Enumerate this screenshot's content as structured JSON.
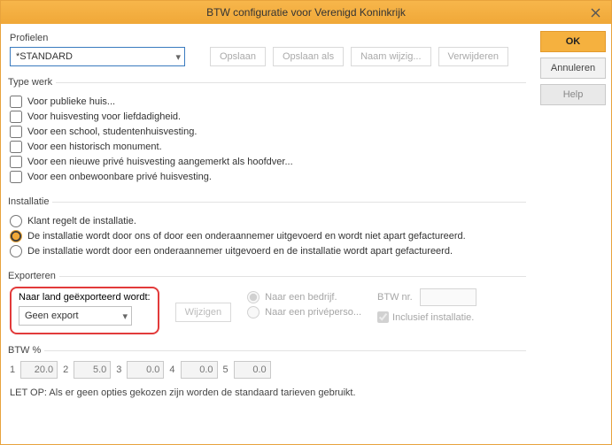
{
  "titlebar": {
    "title": "BTW configuratie voor Verenigd Koninkrijk"
  },
  "side": {
    "ok": "OK",
    "cancel": "Annuleren",
    "help": "Help"
  },
  "profiles": {
    "label": "Profielen",
    "selected": "*STANDARD",
    "buttons": {
      "save": "Opslaan",
      "saveas": "Opslaan als",
      "rename": "Naam wijzig...",
      "delete": "Verwijderen"
    }
  },
  "worktype": {
    "legend": "Type werk",
    "items": [
      "Voor publieke huis...",
      "Voor huisvesting voor liefdadigheid.",
      "Voor een school, studentenhuisvesting.",
      "Voor een historisch monument.",
      "Voor een nieuwe privé huisvesting aangemerkt als hoofdver...",
      "Voor een onbewoonbare privé huisvesting."
    ]
  },
  "install": {
    "legend": "Installatie",
    "options": [
      "Klant regelt de installatie.",
      "De installatie wordt door ons of door een onderaannemer uitgevoerd en wordt niet apart gefactureerd.",
      "De installatie wordt door een onderaannemer uitgevoerd en de installatie wordt apart gefactureerd."
    ]
  },
  "export": {
    "legend": "Exporteren",
    "country_label": "Naar land geëxporteerd wordt:",
    "selected": "Geen export",
    "change": "Wijzigen",
    "to_company": "Naar een bedrijf.",
    "to_private": "Naar een privéperso...",
    "vat_label": "BTW nr.",
    "incl_label": "Inclusief installatie."
  },
  "btw": {
    "legend": "BTW %",
    "rates": [
      "20.0",
      "5.0",
      "0.0",
      "0.0",
      "0.0"
    ]
  },
  "footer": "LET OP: Als er geen opties gekozen zijn worden de standaard tarieven gebruikt."
}
